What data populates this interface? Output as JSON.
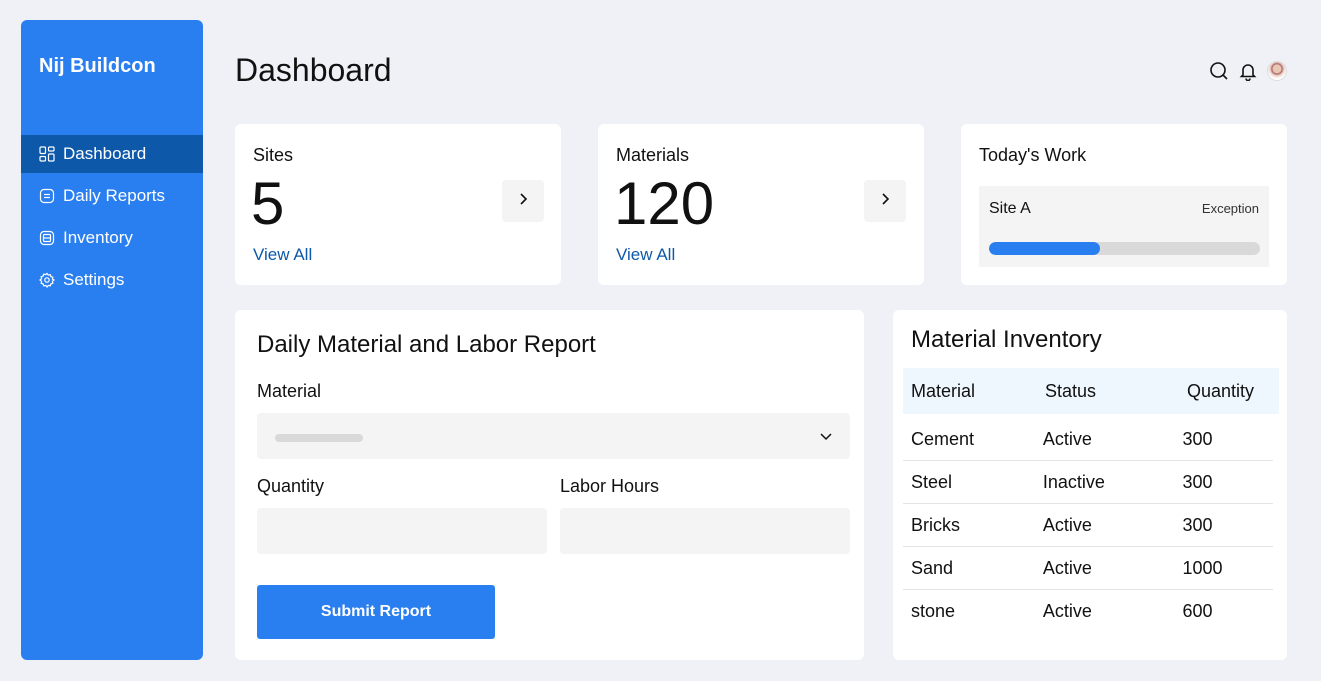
{
  "brand": "Nij Buildcon",
  "nav": [
    {
      "label": "Dashboard",
      "icon": "grid-icon",
      "active": true
    },
    {
      "label": "Daily Reports",
      "icon": "report-icon"
    },
    {
      "label": "Inventory",
      "icon": "inventory-icon"
    },
    {
      "label": "Settings",
      "icon": "gear-icon"
    }
  ],
  "page_title": "Dashboard",
  "stats": {
    "sites": {
      "label": "Sites",
      "value": "5",
      "link": "View All"
    },
    "materials": {
      "label": "Materials",
      "value": "120",
      "link": "View All"
    }
  },
  "today": {
    "title": "Today's Work",
    "site": "Site A",
    "status": "Exception",
    "progress": 0.41
  },
  "report_form": {
    "title": "Daily Material and Labor Report",
    "material_label": "Material",
    "quantity_label": "Quantity",
    "labor_label": "Labor Hours",
    "submit_label": "Submit Report"
  },
  "inventory": {
    "title": "Material Inventory",
    "columns": [
      "Material",
      "Status",
      "Quantity"
    ],
    "rows": [
      [
        "Cement",
        "Active",
        "300"
      ],
      [
        "Steel",
        "Inactive",
        "300"
      ],
      [
        "Bricks",
        "Active",
        "300"
      ],
      [
        "Sand",
        "Active",
        "1000"
      ],
      [
        "stone",
        "Active",
        "600"
      ]
    ]
  },
  "colors": {
    "accent": "#2a7ff0",
    "active_nav": "#0e58aa",
    "link": "#0e58aa"
  }
}
